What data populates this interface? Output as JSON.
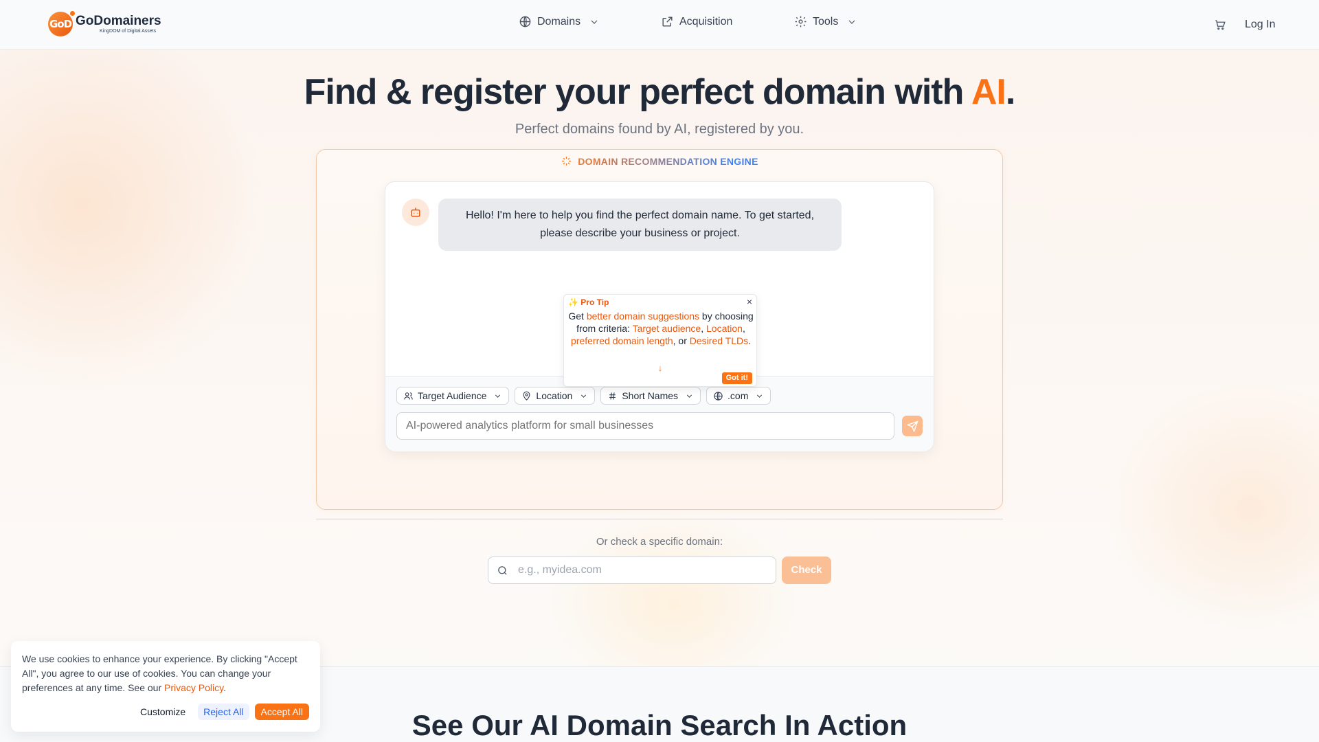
{
  "header": {
    "logo_mark": "GoD",
    "logo_name": "GoDomainers",
    "logo_tagline": "KingDOM of Digital Assets",
    "nav": {
      "domains": "Domains",
      "acquisition": "Acquisition",
      "tools": "Tools"
    },
    "login": "Log In"
  },
  "hero": {
    "title_prefix": "Find & register your perfect domain with ",
    "title_highlight": "AI",
    "title_suffix": ".",
    "subtitle": "Perfect domains found by AI, registered by you."
  },
  "engine": {
    "label": "DOMAIN RECOMMENDATION ENGINE",
    "bot_message": "Hello! I'm here to help you find the perfect domain name. To get started, please describe your business or project.",
    "tip": {
      "title": "Pro Tip",
      "close": "×",
      "text_1": "Get ",
      "hl_1": "better domain suggestions",
      "text_2": " by choosing from criteria: ",
      "hl_2": "Target audience",
      "text_3": ", ",
      "hl_3": "Location",
      "text_4": ", ",
      "hl_4": "preferred domain length",
      "text_5": ", or ",
      "hl_5": "Desired TLDs",
      "text_6": ".",
      "arrow": "↓",
      "got_it": "Got it!"
    },
    "filters": [
      {
        "label": "Target Audience",
        "icon": "users-icon"
      },
      {
        "label": "Location",
        "icon": "map-pin-icon"
      },
      {
        "label": "Short Names",
        "icon": "hash-icon"
      },
      {
        "label": ".com",
        "icon": "globe-icon"
      }
    ],
    "input_placeholder": "AI-powered analytics platform for small businesses"
  },
  "check": {
    "label": "Or check a specific domain:",
    "placeholder": "e.g., myidea.com",
    "button": "Check"
  },
  "section_title": "See Our AI Domain Search In Action",
  "cookie": {
    "text": "We use cookies to enhance your experience. By clicking \"Accept All\", you agree to our use of cookies. You can change your preferences at any time. See our ",
    "link": "Privacy Policy",
    "period": ".",
    "customize": "Customize",
    "reject": "Reject All",
    "accept": "Accept All"
  },
  "colors": {
    "accent": "#f97316",
    "accent_light": "#fdba8c",
    "text": "#1f2937"
  }
}
